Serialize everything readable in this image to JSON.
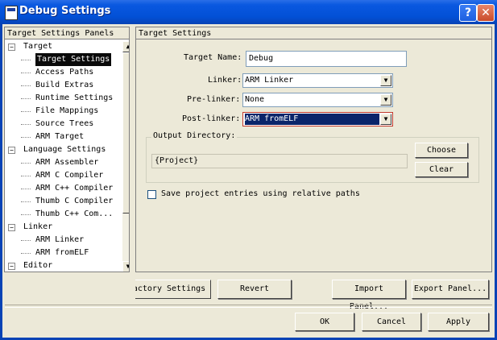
{
  "window": {
    "title": "Debug Settings",
    "help_label": "?",
    "close_label": "✕"
  },
  "panels": {
    "header": "Target Settings Panels",
    "items": [
      {
        "label": "Target",
        "level": 0,
        "expander": "−",
        "selected": false
      },
      {
        "label": "Target Settings",
        "level": 1,
        "selected": true
      },
      {
        "label": "Access Paths",
        "level": 1,
        "selected": false
      },
      {
        "label": "Build Extras",
        "level": 1,
        "selected": false
      },
      {
        "label": "Runtime Settings",
        "level": 1,
        "selected": false
      },
      {
        "label": "File Mappings",
        "level": 1,
        "selected": false
      },
      {
        "label": "Source Trees",
        "level": 1,
        "selected": false
      },
      {
        "label": "ARM Target",
        "level": 1,
        "selected": false
      },
      {
        "label": "Language Settings",
        "level": 0,
        "expander": "−",
        "selected": false
      },
      {
        "label": "ARM Assembler",
        "level": 1,
        "selected": false
      },
      {
        "label": "ARM C Compiler",
        "level": 1,
        "selected": false
      },
      {
        "label": "ARM C++ Compiler",
        "level": 1,
        "selected": false
      },
      {
        "label": "Thumb C Compiler",
        "level": 1,
        "selected": false
      },
      {
        "label": "Thumb C++ Com...",
        "level": 1,
        "selected": false
      },
      {
        "label": "Linker",
        "level": 0,
        "expander": "−",
        "selected": false
      },
      {
        "label": "ARM Linker",
        "level": 1,
        "selected": false
      },
      {
        "label": "ARM fromELF",
        "level": 1,
        "selected": false
      },
      {
        "label": "Editor",
        "level": 0,
        "expander": "−",
        "selected": false
      }
    ]
  },
  "settings": {
    "header": "Target Settings",
    "target_name_label": "Target Name:",
    "target_name_value": "Debug",
    "linker_label": "Linker:",
    "linker_value": "ARM Linker",
    "prelinker_label": "Pre-linker:",
    "prelinker_value": "None",
    "postlinker_label": "Post-linker:",
    "postlinker_value": "ARM fromELF",
    "output_dir_label": "Output Directory:",
    "output_dir_value": "{Project}",
    "choose_label": "Choose",
    "clear_label": "Clear",
    "relative_paths_label": "Save project entries using relative paths",
    "relative_paths_checked": false
  },
  "panel_buttons": {
    "factory_label": "Factory Settings",
    "revert_label": "Revert",
    "import_label": "Import Panel...",
    "export_label": "Export Panel..."
  },
  "dialog_buttons": {
    "ok_label": "OK",
    "cancel_label": "Cancel",
    "apply_label": "Apply"
  },
  "icons": {
    "dropdown": "chevron-down-icon",
    "scroll_up": "arrow-up-icon",
    "scroll_down": "arrow-down-icon"
  },
  "colors": {
    "titlebar": "#0250d6",
    "selection": "#0a246a",
    "dialog_bg": "#ece9d8"
  }
}
